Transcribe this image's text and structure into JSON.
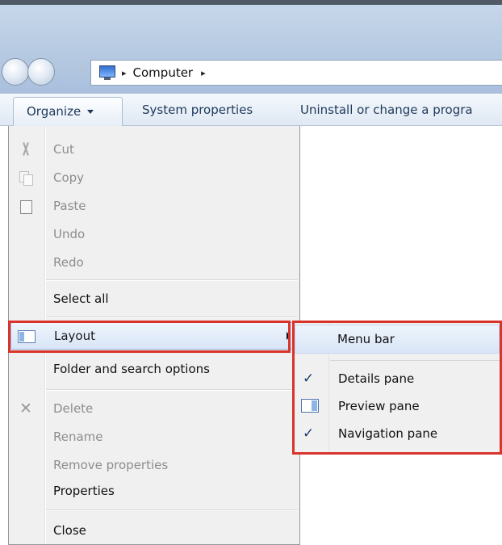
{
  "address": {
    "breadcrumb": "Computer",
    "sep1": "▸",
    "sep2": "▸"
  },
  "toolbar": {
    "organize": "Organize",
    "system_properties": "System properties",
    "uninstall": "Uninstall or change a progra"
  },
  "organize_menu": {
    "cut": "Cut",
    "copy": "Copy",
    "paste": "Paste",
    "undo": "Undo",
    "redo": "Redo",
    "select_all": "Select all",
    "layout": "Layout",
    "folder_options": "Folder and search options",
    "delete": "Delete",
    "rename": "Rename",
    "remove_properties": "Remove properties",
    "properties": "Properties",
    "close": "Close"
  },
  "layout_submenu": {
    "menu_bar": "Menu bar",
    "details_pane": "Details pane",
    "preview_pane": "Preview pane",
    "navigation_pane": "Navigation pane",
    "check_glyph": "✓"
  },
  "colors": {
    "highlight_border": "#d9342b",
    "menu_bg": "#f0f0f0",
    "toolbar_text": "#1e395b"
  }
}
